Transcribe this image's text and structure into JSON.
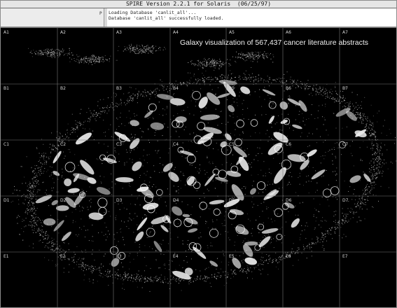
{
  "window": {
    "title": "SPIRE Version 2.2.1 for Solaris  (06/25/97)"
  },
  "console": {
    "prompt": "P",
    "lines": [
      "Loading Database 'canlit_all'...",
      "Database 'canlit_all' successfully loaded."
    ]
  },
  "visualization": {
    "title": "Galaxy visualization of 567,437 cancer literature abstracts",
    "cell_labels": [
      [
        "A1",
        "A2",
        "A3",
        "A4",
        "A5",
        "A6",
        "A7"
      ],
      [
        "B1",
        "B2",
        "B3",
        "B4",
        "B5",
        "B6",
        "B7"
      ],
      [
        "C1",
        "C2",
        "C3",
        "C4",
        "C5",
        "C6",
        "C7"
      ],
      [
        "D1",
        "D2",
        "D3",
        "D4",
        "D5",
        "D6",
        "D7"
      ],
      [
        "E1",
        "E2",
        "E3",
        "E4",
        "E5",
        "E6",
        "E7"
      ]
    ],
    "colors": {
      "background": "#000000",
      "points": "#cfcfcf",
      "grid": "#7a7a7a",
      "cluster_rings": "#ffffff"
    }
  }
}
